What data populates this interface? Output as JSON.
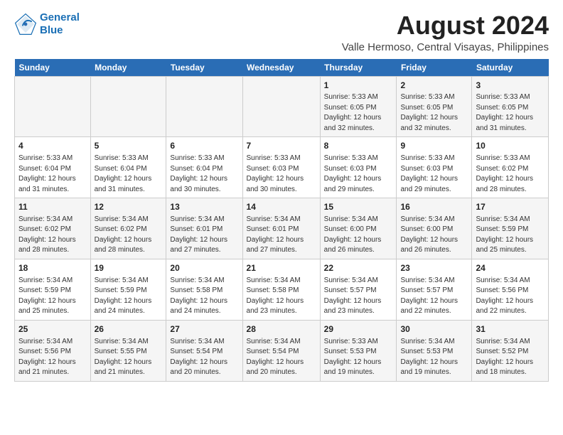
{
  "header": {
    "logo_line1": "General",
    "logo_line2": "Blue",
    "month_year": "August 2024",
    "location": "Valle Hermoso, Central Visayas, Philippines"
  },
  "days_of_week": [
    "Sunday",
    "Monday",
    "Tuesday",
    "Wednesday",
    "Thursday",
    "Friday",
    "Saturday"
  ],
  "weeks": [
    [
      {
        "day": "",
        "content": ""
      },
      {
        "day": "",
        "content": ""
      },
      {
        "day": "",
        "content": ""
      },
      {
        "day": "",
        "content": ""
      },
      {
        "day": "1",
        "content": "Sunrise: 5:33 AM\nSunset: 6:05 PM\nDaylight: 12 hours\nand 32 minutes."
      },
      {
        "day": "2",
        "content": "Sunrise: 5:33 AM\nSunset: 6:05 PM\nDaylight: 12 hours\nand 32 minutes."
      },
      {
        "day": "3",
        "content": "Sunrise: 5:33 AM\nSunset: 6:05 PM\nDaylight: 12 hours\nand 31 minutes."
      }
    ],
    [
      {
        "day": "4",
        "content": "Sunrise: 5:33 AM\nSunset: 6:04 PM\nDaylight: 12 hours\nand 31 minutes."
      },
      {
        "day": "5",
        "content": "Sunrise: 5:33 AM\nSunset: 6:04 PM\nDaylight: 12 hours\nand 31 minutes."
      },
      {
        "day": "6",
        "content": "Sunrise: 5:33 AM\nSunset: 6:04 PM\nDaylight: 12 hours\nand 30 minutes."
      },
      {
        "day": "7",
        "content": "Sunrise: 5:33 AM\nSunset: 6:03 PM\nDaylight: 12 hours\nand 30 minutes."
      },
      {
        "day": "8",
        "content": "Sunrise: 5:33 AM\nSunset: 6:03 PM\nDaylight: 12 hours\nand 29 minutes."
      },
      {
        "day": "9",
        "content": "Sunrise: 5:33 AM\nSunset: 6:03 PM\nDaylight: 12 hours\nand 29 minutes."
      },
      {
        "day": "10",
        "content": "Sunrise: 5:33 AM\nSunset: 6:02 PM\nDaylight: 12 hours\nand 28 minutes."
      }
    ],
    [
      {
        "day": "11",
        "content": "Sunrise: 5:34 AM\nSunset: 6:02 PM\nDaylight: 12 hours\nand 28 minutes."
      },
      {
        "day": "12",
        "content": "Sunrise: 5:34 AM\nSunset: 6:02 PM\nDaylight: 12 hours\nand 28 minutes."
      },
      {
        "day": "13",
        "content": "Sunrise: 5:34 AM\nSunset: 6:01 PM\nDaylight: 12 hours\nand 27 minutes."
      },
      {
        "day": "14",
        "content": "Sunrise: 5:34 AM\nSunset: 6:01 PM\nDaylight: 12 hours\nand 27 minutes."
      },
      {
        "day": "15",
        "content": "Sunrise: 5:34 AM\nSunset: 6:00 PM\nDaylight: 12 hours\nand 26 minutes."
      },
      {
        "day": "16",
        "content": "Sunrise: 5:34 AM\nSunset: 6:00 PM\nDaylight: 12 hours\nand 26 minutes."
      },
      {
        "day": "17",
        "content": "Sunrise: 5:34 AM\nSunset: 5:59 PM\nDaylight: 12 hours\nand 25 minutes."
      }
    ],
    [
      {
        "day": "18",
        "content": "Sunrise: 5:34 AM\nSunset: 5:59 PM\nDaylight: 12 hours\nand 25 minutes."
      },
      {
        "day": "19",
        "content": "Sunrise: 5:34 AM\nSunset: 5:59 PM\nDaylight: 12 hours\nand 24 minutes."
      },
      {
        "day": "20",
        "content": "Sunrise: 5:34 AM\nSunset: 5:58 PM\nDaylight: 12 hours\nand 24 minutes."
      },
      {
        "day": "21",
        "content": "Sunrise: 5:34 AM\nSunset: 5:58 PM\nDaylight: 12 hours\nand 23 minutes."
      },
      {
        "day": "22",
        "content": "Sunrise: 5:34 AM\nSunset: 5:57 PM\nDaylight: 12 hours\nand 23 minutes."
      },
      {
        "day": "23",
        "content": "Sunrise: 5:34 AM\nSunset: 5:57 PM\nDaylight: 12 hours\nand 22 minutes."
      },
      {
        "day": "24",
        "content": "Sunrise: 5:34 AM\nSunset: 5:56 PM\nDaylight: 12 hours\nand 22 minutes."
      }
    ],
    [
      {
        "day": "25",
        "content": "Sunrise: 5:34 AM\nSunset: 5:56 PM\nDaylight: 12 hours\nand 21 minutes."
      },
      {
        "day": "26",
        "content": "Sunrise: 5:34 AM\nSunset: 5:55 PM\nDaylight: 12 hours\nand 21 minutes."
      },
      {
        "day": "27",
        "content": "Sunrise: 5:34 AM\nSunset: 5:54 PM\nDaylight: 12 hours\nand 20 minutes."
      },
      {
        "day": "28",
        "content": "Sunrise: 5:34 AM\nSunset: 5:54 PM\nDaylight: 12 hours\nand 20 minutes."
      },
      {
        "day": "29",
        "content": "Sunrise: 5:33 AM\nSunset: 5:53 PM\nDaylight: 12 hours\nand 19 minutes."
      },
      {
        "day": "30",
        "content": "Sunrise: 5:34 AM\nSunset: 5:53 PM\nDaylight: 12 hours\nand 19 minutes."
      },
      {
        "day": "31",
        "content": "Sunrise: 5:34 AM\nSunset: 5:52 PM\nDaylight: 12 hours\nand 18 minutes."
      }
    ]
  ]
}
